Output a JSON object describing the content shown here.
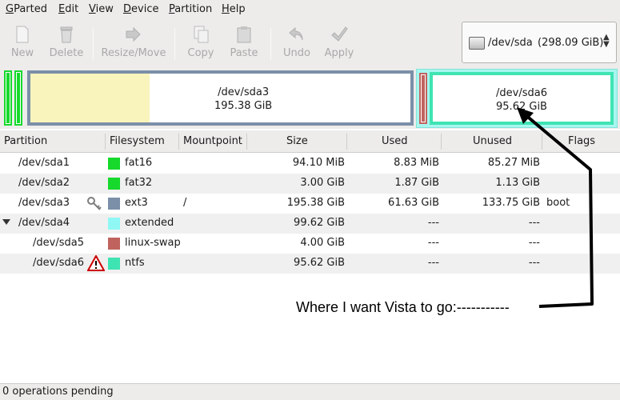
{
  "menu": {
    "items": [
      "GParted",
      "Edit",
      "View",
      "Device",
      "Partition",
      "Help"
    ]
  },
  "toolbar": {
    "buttons": [
      {
        "label": "New",
        "icon": "new-icon"
      },
      {
        "label": "Delete",
        "icon": "delete-icon"
      },
      {
        "label": "Resize/Move",
        "icon": "resize-move-icon"
      },
      {
        "label": "Copy",
        "icon": "copy-icon"
      },
      {
        "label": "Paste",
        "icon": "paste-icon"
      },
      {
        "label": "Undo",
        "icon": "undo-icon"
      },
      {
        "label": "Apply",
        "icon": "apply-icon"
      }
    ],
    "device": {
      "name": "/dev/sda",
      "size": "(298.09 GiB)",
      "icon": "harddisk-icon"
    }
  },
  "disk_graphic": {
    "sda3": {
      "name": "/dev/sda3",
      "size": "195.38 GiB"
    },
    "sda6": {
      "name": "/dev/sda6",
      "size": "95.62 GiB"
    }
  },
  "table": {
    "headers": [
      "Partition",
      "Filesystem",
      "Mountpoint",
      "Size",
      "Used",
      "Unused",
      "Flags"
    ],
    "rows": [
      {
        "partition": "/dev/sda1",
        "filesystem": "fat16",
        "fs_color": "#16d92c",
        "mountpoint": "",
        "size": "94.10 MiB",
        "used": "8.83 MiB",
        "unused": "85.27 MiB",
        "flags": ""
      },
      {
        "partition": "/dev/sda2",
        "filesystem": "fat32",
        "fs_color": "#16d92c",
        "mountpoint": "",
        "size": "3.00 GiB",
        "used": "1.87 GiB",
        "unused": "1.13 GiB",
        "flags": ""
      },
      {
        "partition": "/dev/sda3",
        "filesystem": "ext3",
        "fs_color": "#7b8fa8",
        "mountpoint": "/",
        "size": "195.38 GiB",
        "used": "61.63 GiB",
        "unused": "133.75 GiB",
        "flags": "boot",
        "icon": "key-icon"
      },
      {
        "partition": "/dev/sda4",
        "filesystem": "extended",
        "fs_color": "#8ff8f5",
        "mountpoint": "",
        "size": "99.62 GiB",
        "used": "---",
        "unused": "---",
        "flags": ""
      },
      {
        "partition": "/dev/sda5",
        "filesystem": "linux-swap",
        "fs_color": "#c0635f",
        "mountpoint": "",
        "size": "4.00 GiB",
        "used": "---",
        "unused": "---",
        "flags": ""
      },
      {
        "partition": "/dev/sda6",
        "filesystem": "ntfs",
        "fs_color": "#3fe4b3",
        "mountpoint": "",
        "size": "95.62 GiB",
        "used": "---",
        "unused": "---",
        "flags": "",
        "icon": "warning-icon"
      }
    ]
  },
  "status": {
    "text": "0 operations pending"
  },
  "annotation": {
    "text": "Where I want Vista to go:-----------"
  }
}
